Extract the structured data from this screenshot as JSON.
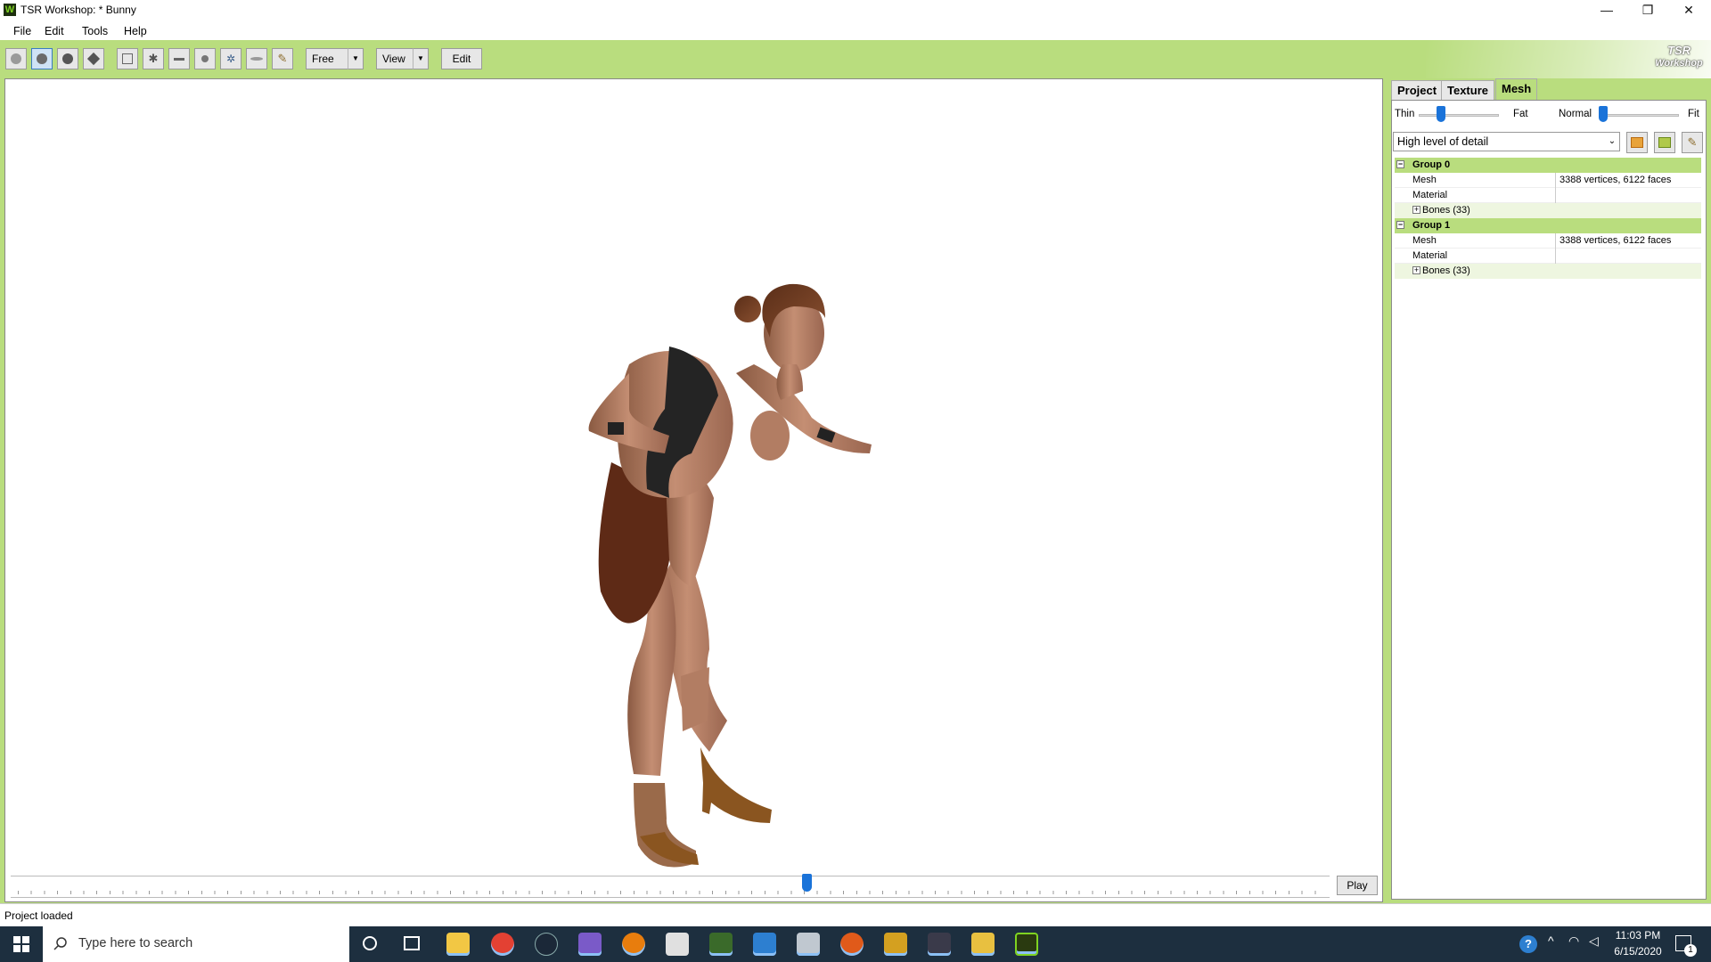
{
  "window": {
    "title": "TSR Workshop: * Bunny",
    "app_icon_letter": "W",
    "minimize_glyph": "—",
    "restore_glyph": "❐",
    "close_glyph": "✕"
  },
  "menu": [
    "File",
    "Edit",
    "Tools",
    "Help"
  ],
  "toolbar": {
    "camera_mode": "Free",
    "view_label": "View",
    "edit_label": "Edit",
    "logo_line1": "TSR",
    "logo_line2": "Workshop"
  },
  "timeline": {
    "play_label": "Play",
    "position": 0.6
  },
  "panel": {
    "tabs": [
      "Project",
      "Texture",
      "Mesh"
    ],
    "active_tab": "Mesh",
    "body_slider": {
      "left_label": "Thin",
      "right_label": "Fat",
      "value": 0.25
    },
    "fitness_slider": {
      "left_label": "Normal",
      "right_label": "Fit",
      "value": 0.0
    },
    "lod_selected": "High level of detail",
    "groups": [
      {
        "name": "Group 0",
        "mesh_label": "Mesh",
        "mesh_value": "3388 vertices, 6122 faces",
        "material_label": "Material",
        "material_value": "",
        "bones_label": "Bones (33)"
      },
      {
        "name": "Group 1",
        "mesh_label": "Mesh",
        "mesh_value": "3388 vertices, 6122 faces",
        "material_label": "Material",
        "material_value": "",
        "bones_label": "Bones (33)"
      }
    ]
  },
  "status": {
    "text": "Project loaded"
  },
  "taskbar": {
    "search_placeholder": "Type here to search",
    "time": "11:03 PM",
    "date": "6/15/2020",
    "notification_count": "1"
  },
  "colors": {
    "accent_green": "#b9dd7e",
    "slider_blue": "#1a73d9",
    "taskbar": "#1d2f3f"
  }
}
